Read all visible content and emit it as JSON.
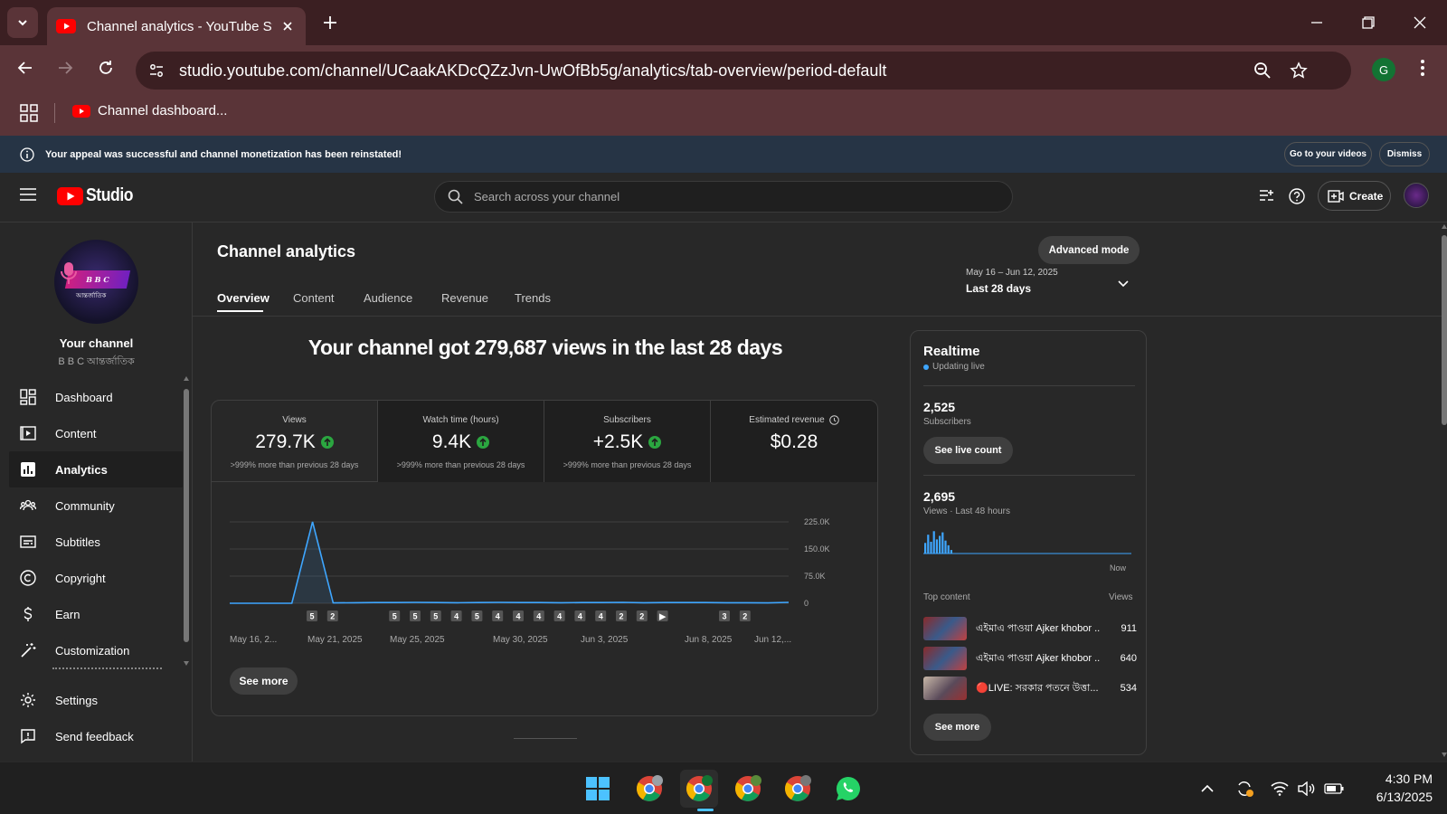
{
  "browser": {
    "tab_title": "Channel analytics - YouTube Studio",
    "url": "studio.youtube.com/channel/UCaakAKDcQZzJvn-UwOfBb5g/analytics/tab-overview/period-default",
    "profile_initial": "G",
    "bookmark_label": "Channel dashboard..."
  },
  "notice": {
    "message": "Your appeal was successful and channel monetization has been reinstated!",
    "go_label": "Go to your videos",
    "dismiss_label": "Dismiss"
  },
  "header": {
    "logo_text": "Studio",
    "search_placeholder": "Search across your channel",
    "create_label": "Create"
  },
  "sidebar": {
    "channel_title": "Your channel",
    "channel_name": "B B C আন্তর্জাতিক",
    "avatar_text": "B B C",
    "avatar_subtext": "আন্তর্জাতিক",
    "items": [
      {
        "label": "Dashboard",
        "icon": "dashboard-icon"
      },
      {
        "label": "Content",
        "icon": "content-icon"
      },
      {
        "label": "Analytics",
        "icon": "analytics-icon"
      },
      {
        "label": "Community",
        "icon": "community-icon"
      },
      {
        "label": "Subtitles",
        "icon": "subtitles-icon"
      },
      {
        "label": "Copyright",
        "icon": "copyright-icon"
      },
      {
        "label": "Earn",
        "icon": "earn-icon"
      },
      {
        "label": "Customization",
        "icon": "customization-icon"
      }
    ],
    "settings_label": "Settings",
    "feedback_label": "Send feedback"
  },
  "analytics": {
    "page_title": "Channel analytics",
    "advanced_mode_label": "Advanced mode",
    "tabs": [
      "Overview",
      "Content",
      "Audience",
      "Revenue",
      "Trends"
    ],
    "active_tab": "Overview",
    "date_range": "May 16 – Jun 12, 2025",
    "period_label": "Last 28 days",
    "headline": "Your channel got 279,687 views in the last 28 days",
    "metrics": [
      {
        "label": "Views",
        "value": "279.7K",
        "sub": ">999% more than previous 28 days",
        "trend": "up"
      },
      {
        "label": "Watch time (hours)",
        "value": "9.4K",
        "sub": ">999% more than previous 28 days",
        "trend": "up"
      },
      {
        "label": "Subscribers",
        "value": "+2.5K",
        "sub": ">999% more than previous 28 days",
        "trend": "up"
      },
      {
        "label": "Estimated revenue",
        "value": "$0.28",
        "sub": "",
        "trend": "none"
      }
    ],
    "see_more_label": "See more"
  },
  "chart_data": {
    "type": "area",
    "title": "",
    "xlabel": "",
    "ylabel": "",
    "ylim": [
      0,
      225000
    ],
    "yticks": [
      "0",
      "75.0K",
      "150.0K",
      "225.0K"
    ],
    "grid": true,
    "x_tick_labels": [
      "May 16, 2...",
      "May 21, 2025",
      "May 25, 2025",
      "May 30, 2025",
      "Jun 3, 2025",
      "Jun 8, 2025",
      "Jun 12,..."
    ],
    "series": [
      {
        "values": [
          0,
          0,
          0,
          0,
          225000,
          1000,
          1500,
          2000,
          2000,
          2500,
          2000,
          1500,
          2000,
          2500,
          2000,
          2000,
          1500,
          2000,
          2000,
          2500,
          1500,
          2000,
          2000,
          2000,
          1500,
          1500,
          1000,
          2500
        ]
      }
    ],
    "upload_markers": [
      "5",
      "2",
      "",
      "",
      "5",
      "5",
      "5",
      "4",
      "5",
      "4",
      "4",
      "4",
      "4",
      "4",
      "4",
      "2",
      "2",
      "▶",
      "",
      "",
      "3",
      "2"
    ],
    "color": "#3ea6ff"
  },
  "realtime": {
    "title": "Realtime",
    "status": "Updating live",
    "subscribers_value": "2,525",
    "subscribers_label": "Subscribers",
    "live_count_label": "See live count",
    "views_value": "2,695",
    "views_label": "Views · Last 48 hours",
    "now_label": "Now",
    "bars": [
      0.45,
      0.8,
      0.5,
      0.95,
      0.6,
      0.75,
      0.9,
      0.55,
      0.35,
      0.15
    ],
    "top_content_label": "Top content",
    "views_col_label": "Views",
    "top_content": [
      {
        "title": "এইমাএ পাওয়া Ajker khobor ...",
        "views": "911"
      },
      {
        "title": "এইমাএ পাওয়া Ajker khobor ...",
        "views": "640"
      },
      {
        "title": "🔴LIVE: সরকার পতনে উত্তা...",
        "views": "534"
      }
    ],
    "see_more_label": "See more"
  },
  "taskbar": {
    "time": "4:30 PM",
    "date": "6/13/2025"
  },
  "colors": {
    "accent_blue": "#3ea6ff",
    "youtube_red": "#ff0000",
    "green_up": "#2ba640"
  }
}
